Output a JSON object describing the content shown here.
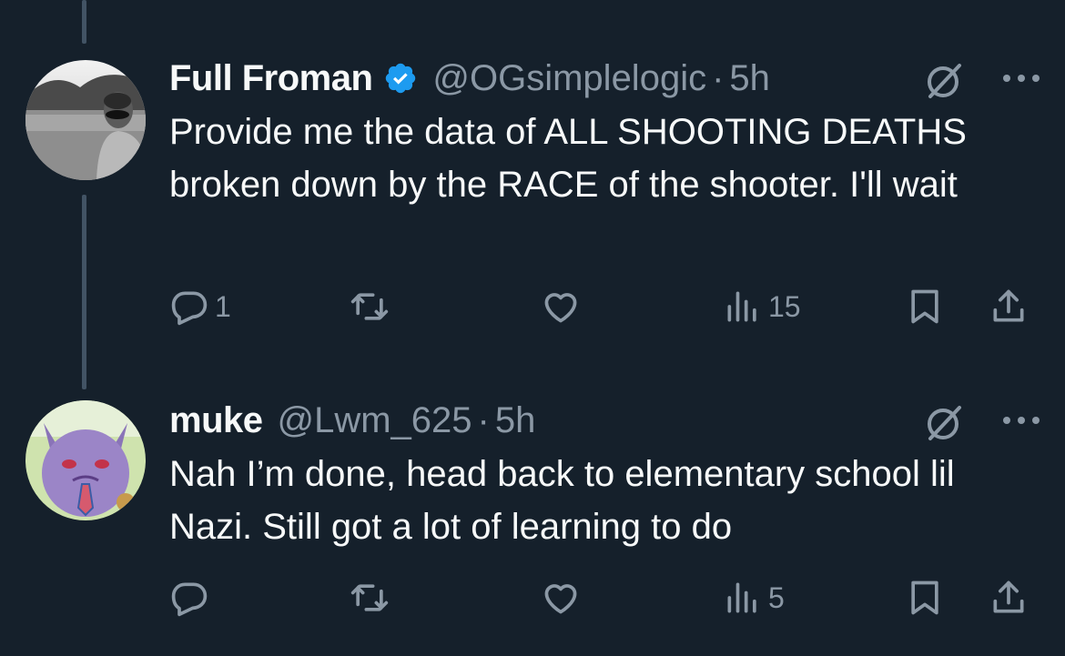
{
  "colors": {
    "background": "#15202b",
    "text_primary": "#f7f9f9",
    "text_secondary": "#8b98a5",
    "verified": "#1d9bf0",
    "thread_line": "#425364"
  },
  "tweets": [
    {
      "name": "Full Froman",
      "verified": true,
      "handle": "@OGsimplelogic",
      "separator": "·",
      "time": "5h",
      "text": "Provide me the data of ALL SHOOTING DEATHS broken down by the RACE of the shooter. I'll wait",
      "reply_count": "1",
      "retweet_count": "",
      "like_count": "",
      "view_count": "15",
      "icons": [
        "reply-icon",
        "retweet-icon",
        "like-icon",
        "views-icon",
        "bookmark-icon",
        "share-icon",
        "grok-icon",
        "more-icon"
      ]
    },
    {
      "name": "muke",
      "verified": false,
      "handle": "@Lwm_625",
      "separator": "·",
      "time": "5h",
      "text": "Nah I’m done, head back to elementary school lil Nazi. Still got a lot of learning to do",
      "reply_count": "",
      "retweet_count": "",
      "like_count": "",
      "view_count": "5",
      "icons": [
        "reply-icon",
        "retweet-icon",
        "like-icon",
        "views-icon",
        "bookmark-icon",
        "share-icon",
        "grok-icon",
        "more-icon"
      ]
    }
  ]
}
